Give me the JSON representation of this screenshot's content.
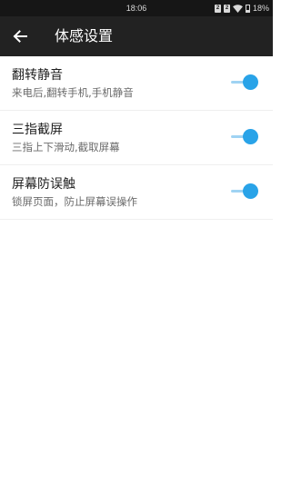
{
  "status_bar": {
    "time": "18:06",
    "sim1": "2",
    "sim2": "2",
    "wifi_icon": "wifi-icon",
    "battery_percent": "18%",
    "battery_level": 0.18
  },
  "header": {
    "back_icon": "arrow-left-icon",
    "title": "体感设置"
  },
  "settings": [
    {
      "title": "翻转静音",
      "desc": "来电后,翻转手机,手机静音",
      "enabled": true
    },
    {
      "title": "三指截屏",
      "desc": "三指上下滑动,截取屏幕",
      "enabled": true
    },
    {
      "title": "屏幕防误触",
      "desc": "锁屏页面，防止屏幕误操作",
      "enabled": true
    }
  ],
  "colors": {
    "status_bar_bg": "#161616",
    "app_bar_bg": "#222222",
    "accent": "#29a3e8",
    "track": "#9fd3f3"
  }
}
